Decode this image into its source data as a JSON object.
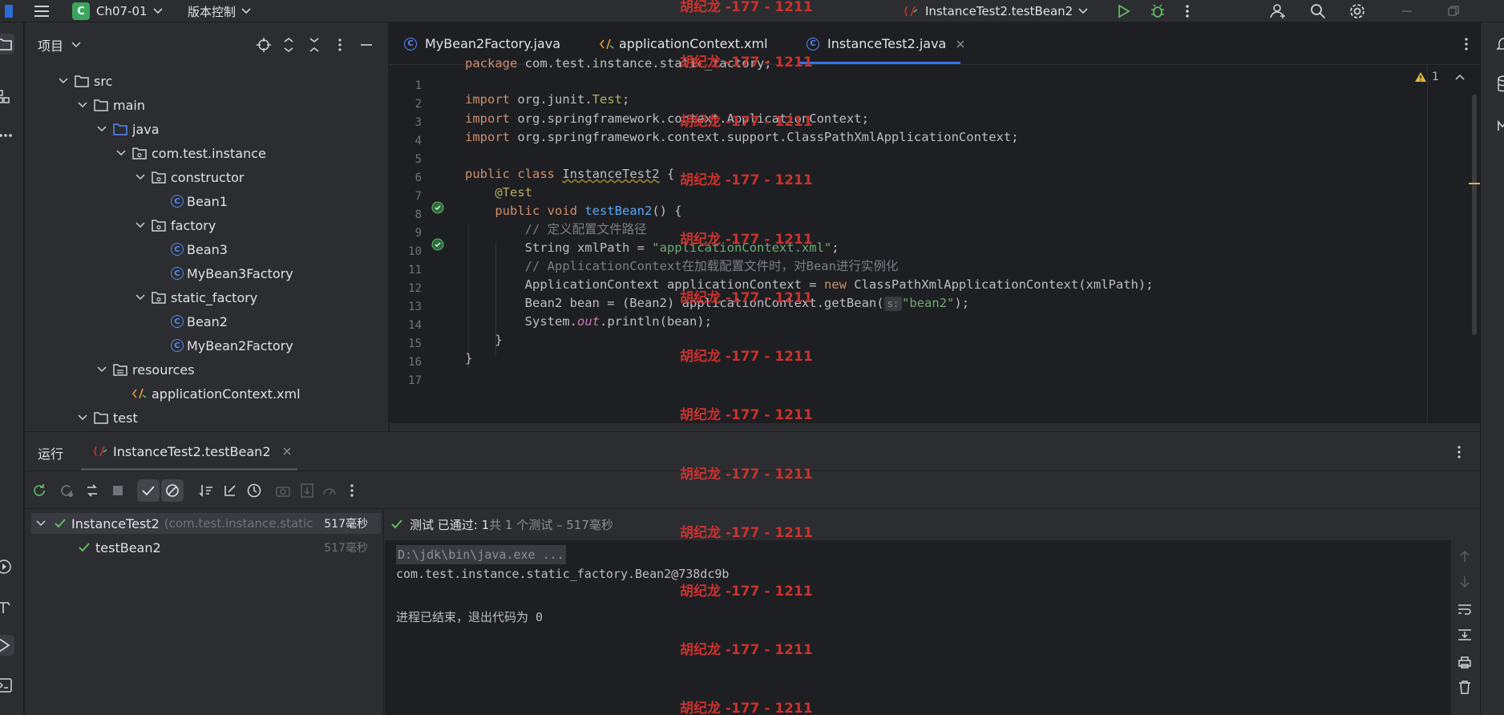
{
  "topbar": {
    "project_initial": "C",
    "project_name": "Ch07-01",
    "vcs": "版本控制",
    "run_config": "InstanceTest2.testBean2",
    "watermark": "胡纪龙 -177 - 1211"
  },
  "project_panel": {
    "title": "项目",
    "tree": [
      {
        "label": "src",
        "kind": "folder"
      },
      {
        "label": "main",
        "kind": "folder"
      },
      {
        "label": "java",
        "kind": "source-folder"
      },
      {
        "label": "com.test.instance",
        "kind": "package"
      },
      {
        "label": "constructor",
        "kind": "package"
      },
      {
        "label": "Bean1",
        "kind": "class"
      },
      {
        "label": "factory",
        "kind": "package"
      },
      {
        "label": "Bean3",
        "kind": "class"
      },
      {
        "label": "MyBean3Factory",
        "kind": "class"
      },
      {
        "label": "static_factory",
        "kind": "package"
      },
      {
        "label": "Bean2",
        "kind": "class"
      },
      {
        "label": "MyBean2Factory",
        "kind": "class"
      },
      {
        "label": "resources",
        "kind": "resources-folder"
      },
      {
        "label": "applicationContext.xml",
        "kind": "xml"
      },
      {
        "label": "test",
        "kind": "folder"
      }
    ]
  },
  "editor": {
    "tabs": [
      {
        "label": "MyBean2Factory.java",
        "active": false
      },
      {
        "label": "applicationContext.xml",
        "active": false
      },
      {
        "label": "InstanceTest2.java",
        "active": true
      }
    ],
    "warning_count": "1",
    "line_numbers": [
      "1",
      "2",
      "3",
      "4",
      "5",
      "6",
      "7",
      "8",
      "9",
      "10",
      "11",
      "12",
      "13",
      "14",
      "15",
      "16",
      "17"
    ],
    "code": {
      "l1_kw": "package",
      "l1_rest": " com.test.instance.static_factory;",
      "l3_kw": "import",
      "l3_a": " org.junit.",
      "l3_b": "Test",
      "l3_c": ";",
      "l4_kw": "import",
      "l4_rest": " org.springframework.context.ApplicationContext;",
      "l5_kw": "import",
      "l5_rest": " org.springframework.context.support.ClassPathXmlApplicationContext;",
      "l7_kw": "public class ",
      "l7_name": "InstanceTest2",
      "l7_rest": " {",
      "l8_ann": "@Test",
      "l9_kw": "public void ",
      "l9_fn": "testBean2",
      "l9_rest": "() {",
      "l10_cmt": "// 定义配置文件路径",
      "l11_a": "String xmlPath = ",
      "l11_str": "\"applicationContext.xml\"",
      "l11_c": ";",
      "l12_cmt": "// ApplicationContext在加载配置文件时，对Bean进行实例化",
      "l13_a": "ApplicationContext applicationContext = ",
      "l13_kw": "new",
      "l13_b": " ClassPathXmlApplicationContext(xmlPath);",
      "l14_a": "Bean2 bean = (Bean2) applicationContext.getBean(",
      "l14_hint": "s:",
      "l14_str": "\"bean2\"",
      "l14_c": ");",
      "l15_a": "System.",
      "l15_fld": "out",
      "l15_b": ".println(bean);",
      "l16": "}",
      "l17": "}"
    }
  },
  "run_panel": {
    "title": "运行",
    "tab_label": "InstanceTest2.testBean2",
    "tests": [
      {
        "name": "InstanceTest2",
        "detail": "(com.test.instance.static",
        "time": "517毫秒"
      },
      {
        "name": "testBean2",
        "detail": "",
        "time": "517毫秒"
      }
    ],
    "status": {
      "passed": "测试 已通过: 1",
      "summary": "共 1 个测试 – 517毫秒"
    },
    "console": [
      "D:\\jdk\\bin\\java.exe ...",
      "com.test.instance.static_factory.Bean2@738dc9b",
      "",
      "进程已结束，退出代码为 0"
    ]
  },
  "colors": {
    "accent": "#3574f0",
    "pass": "#5fb865",
    "watermark": "#c9322e"
  }
}
